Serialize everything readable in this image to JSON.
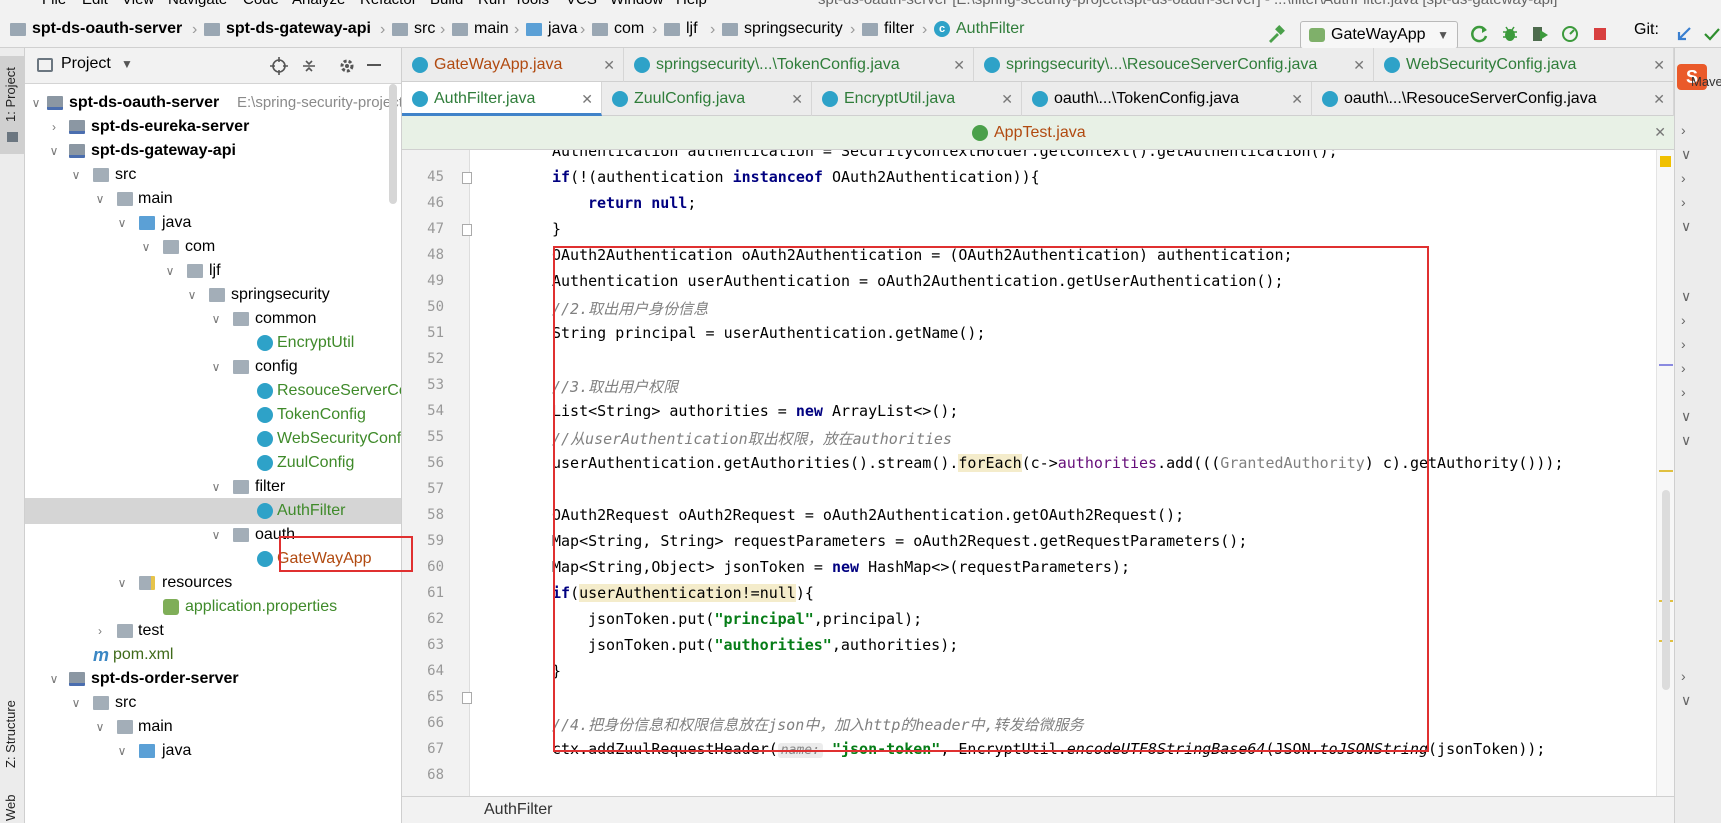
{
  "menu": [
    "File",
    "Edit",
    "View",
    "Navigate",
    "Code",
    "Analyze",
    "Refactor",
    "Build",
    "Run",
    "Tools",
    "VCS",
    "Window",
    "Help"
  ],
  "window_title": "spt-ds-oauth-server [E:\\spring-security-project\\spt-ds-oauth-server] - ...\\filter\\AuthFilter.java [spt-ds-gateway-api]",
  "breadcrumb": [
    "spt-ds-oauth-server",
    "spt-ds-gateway-api",
    "src",
    "main",
    "java",
    "com",
    "ljf",
    "springsecurity",
    "filter",
    "AuthFilter"
  ],
  "toolbar": {
    "run_config": "GateWayApp",
    "git_label": "Git:"
  },
  "stripes": {
    "project": "1: Project",
    "structure": "Z: Structure",
    "web": "Web",
    "maven": "Maven"
  },
  "project_panel": {
    "title": "Project",
    "root_path": "E:\\spring-security-project",
    "tree": [
      {
        "label": "spt-ds-oauth-server",
        "bold": true
      },
      {
        "label": "spt-ds-eureka-server",
        "bold": true
      },
      {
        "label": "spt-ds-gateway-api",
        "bold": true
      },
      {
        "label": "src"
      },
      {
        "label": "main"
      },
      {
        "label": "java"
      },
      {
        "label": "com"
      },
      {
        "label": "ljf"
      },
      {
        "label": "springsecurity"
      },
      {
        "label": "common"
      },
      {
        "label": "EncryptUtil"
      },
      {
        "label": "config"
      },
      {
        "label": "ResouceServerConfig"
      },
      {
        "label": "TokenConfig"
      },
      {
        "label": "WebSecurityConfig"
      },
      {
        "label": "ZuulConfig"
      },
      {
        "label": "filter"
      },
      {
        "label": "AuthFilter"
      },
      {
        "label": "oauth"
      },
      {
        "label": "GateWayApp"
      },
      {
        "label": "resources"
      },
      {
        "label": "application.properties"
      },
      {
        "label": "test"
      },
      {
        "label": "pom.xml"
      },
      {
        "label": "spt-ds-order-server",
        "bold": true
      },
      {
        "label": "src"
      },
      {
        "label": "main"
      },
      {
        "label": "java"
      }
    ]
  },
  "tabs_row1": [
    "GateWayApp.java",
    "springsecurity\\...\\TokenConfig.java",
    "springsecurity\\...\\ResouceServerConfig.java",
    "WebSecurityConfig.java"
  ],
  "tabs_row2": [
    "AuthFilter.java",
    "ZuulConfig.java",
    "EncryptUtil.java",
    "oauth\\...\\TokenConfig.java",
    "oauth\\...\\ResouceServerConfig.java"
  ],
  "tabs_row3": [
    "AppTest.java"
  ],
  "line_numbers": [
    "45",
    "46",
    "47",
    "48",
    "49",
    "50",
    "51",
    "52",
    "53",
    "54",
    "55",
    "56",
    "57",
    "58",
    "59",
    "60",
    "61",
    "62",
    "63",
    "64",
    "65",
    "66",
    "67",
    "68"
  ],
  "code": {
    "l44": "Authentication authentication = SecurityContextHolder.getContext().getAuthentication();",
    "l45a": "if",
    "l45b": "(!(authentication ",
    "l45c": "instanceof",
    "l45d": " OAuth2Authentication)){",
    "l46a": "return",
    "l46b": " ",
    "l46c": "null",
    "l46d": ";",
    "l47": "}",
    "l48": "OAuth2Authentication oAuth2Authentication = (OAuth2Authentication) authentication;",
    "l49": "Authentication userAuthentication = oAuth2Authentication.getUserAuthentication();",
    "l50": "//2.取出用户身份信息",
    "l51": "String principal = userAuthentication.getName();",
    "l53": "//3.取出用户权限",
    "l54a": "List<String> authorities = ",
    "l54b": "new",
    "l54c": " ArrayList<>();",
    "l55": "//从userAuthentication取出权限，放在authorities",
    "l56a": "userAuthentication.getAuthorities().stream().",
    "l56b": "forEach",
    "l56c": "(c->",
    "l56d": "authorities",
    "l56e": ".add(((",
    "l56f": "GrantedAuthority",
    "l56g": ") c).getAuthority()));",
    "l58": "OAuth2Request oAuth2Request = oAuth2Authentication.getOAuth2Request();",
    "l59": "Map<String, String> requestParameters = oAuth2Request.getRequestParameters();",
    "l60a": "Map<String,Object> jsonToken = ",
    "l60b": "new",
    "l60c": " HashMap<>(requestParameters);",
    "l61a": "if",
    "l61b": "(",
    "l61c": "userAuthentication!=null",
    "l61d": "){",
    "l62a": "jsonToken.put(",
    "l62b": "\"principal\"",
    "l62c": ",principal);",
    "l63a": "jsonToken.put(",
    "l63b": "\"authorities\"",
    "l63c": ",authorities);",
    "l64": "}",
    "l66": "//4.把身份信息和权限信息放在json中，加入http的header中,转发给微服务",
    "l67a": "ctx.addZuulRequestHeader(",
    "l67b": "name:",
    "l67c": " \"json-token\"",
    "l67d": ", EncryptUtil.",
    "l67e": "encodeUTF8StringBase64",
    "l67f": "(JSON.",
    "l67g": "toJSONString",
    "l67h": "(jsonToken));"
  },
  "status": {
    "breadcrumb": "AuthFilter"
  },
  "colors": {
    "highlight_box": "#e03030",
    "keyword": "#000080",
    "string": "#067d17",
    "comment": "#808080"
  }
}
